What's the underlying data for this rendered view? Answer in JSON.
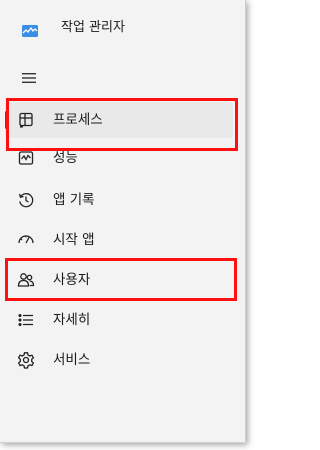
{
  "window": {
    "title": "작업 관리자"
  },
  "nav": {
    "menu_icon": "hamburger-icon",
    "items": [
      {
        "id": "processes",
        "label": "프로세스",
        "icon": "processes-icon",
        "selected": true
      },
      {
        "id": "performance",
        "label": "성능",
        "icon": "performance-icon",
        "selected": false
      },
      {
        "id": "app-history",
        "label": "앱 기록",
        "icon": "app-history-icon",
        "selected": false
      },
      {
        "id": "startup-apps",
        "label": "시작 앱",
        "icon": "startup-apps-icon",
        "selected": false
      },
      {
        "id": "users",
        "label": "사용자",
        "icon": "users-icon",
        "selected": false
      },
      {
        "id": "details",
        "label": "자세히",
        "icon": "details-icon",
        "selected": false
      },
      {
        "id": "services",
        "label": "서비스",
        "icon": "services-icon",
        "selected": false
      }
    ]
  },
  "colors": {
    "accent": "#005fb8",
    "highlight_border": "#ff1010",
    "sidebar_bg": "#f3f3f3",
    "selected_bg": "#e9e9e9"
  }
}
